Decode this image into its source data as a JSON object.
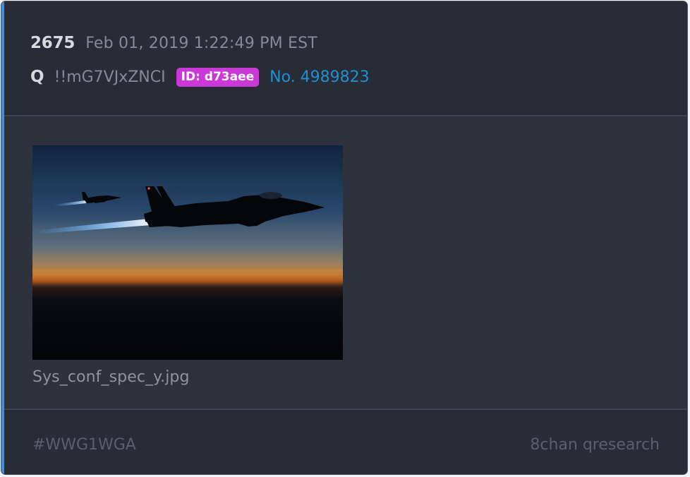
{
  "post": {
    "number": "2675",
    "timestamp": "Feb 01, 2019 1:22:49 PM EST",
    "author": "Q",
    "tripcode": "!!mG7VJxZNCI",
    "id_badge": "ID: d73aee",
    "post_link": "No. 4989823"
  },
  "attachment": {
    "filename": "Sys_conf_spec_y.jpg",
    "image_subject": "fighter-jets-at-dusk"
  },
  "footer": {
    "tag": "#WWG1WGA",
    "source": "8chan qresearch"
  },
  "colors": {
    "accent_bar": "#3d8fdd",
    "id_badge_bg": "#ca39d6",
    "link": "#1f8fd3",
    "card_bg": "#2d323d",
    "header_bg": "#282c36"
  }
}
